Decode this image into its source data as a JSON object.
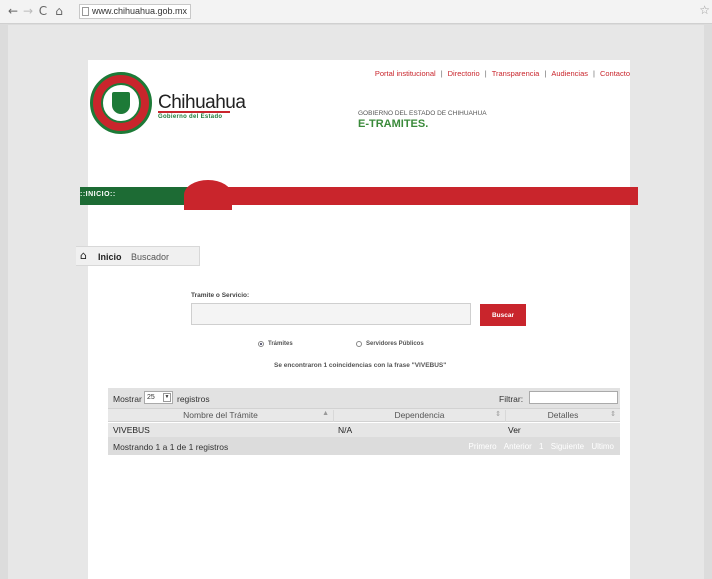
{
  "browser": {
    "url": "www.chihuahua.gob.mx"
  },
  "header": {
    "brand_name": "Chihuahua",
    "brand_sub": "Gobierno del Estado",
    "nav": [
      "Portal institucional",
      "Directorio",
      "Transparencia",
      "Audiencias",
      "Contacto"
    ],
    "gov_text": "GOBIERNO DEL ESTADO DE CHIHUAHUA",
    "section_title": "E-TRAMITES.",
    "tab_label": "::INICIO::"
  },
  "breadcrumb": {
    "items": [
      "Inicio",
      "Buscador"
    ]
  },
  "search": {
    "label": "Tramite o Servicio:",
    "value": "",
    "button": "Buscar",
    "options": [
      {
        "label": "Trámites",
        "checked": true
      },
      {
        "label": "Servidores Públicos",
        "checked": false
      }
    ],
    "result_message": "Se encontraron 1 coincidencias con la frase \"VIVEBUS\""
  },
  "table": {
    "show_label": "Mostrar",
    "page_size": "25",
    "records_label": "registros",
    "filter_label": "Filtrar:",
    "columns": [
      "Nombre del Trámite",
      "Dependencia",
      "Detalles"
    ],
    "rows": [
      [
        "VIVEBUS",
        "N/A",
        "Ver"
      ]
    ],
    "info": "Mostrando 1 a 1 de 1 registros",
    "pagination": [
      "Primero",
      "Anterior",
      "1",
      "Siguiente",
      "Ultimo"
    ]
  },
  "colors": {
    "brand_red": "#c9252c",
    "brand_green": "#1d6b34"
  }
}
